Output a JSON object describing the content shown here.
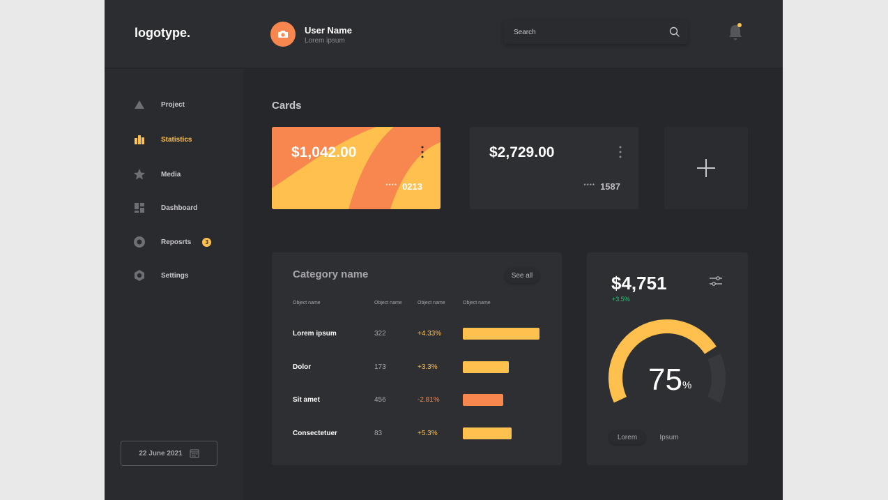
{
  "header": {
    "logo": "logotype.",
    "user_name": "User Name",
    "user_sub": "Lorem ipsum",
    "search_placeholder": "Search"
  },
  "sidebar": {
    "items": [
      {
        "label": "Project",
        "icon": "triangle-icon"
      },
      {
        "label": "Statistics",
        "icon": "bar-chart-icon",
        "active": true
      },
      {
        "label": "Media",
        "icon": "star-icon"
      },
      {
        "label": "Dashboard",
        "icon": "dashboard-icon"
      },
      {
        "label": "Reposrts",
        "icon": "reports-icon",
        "badge": "3"
      },
      {
        "label": "Settings",
        "icon": "settings-icon"
      }
    ],
    "date": "22 June 2021"
  },
  "cards": {
    "title": "Cards",
    "items": [
      {
        "amount": "$1,042.00",
        "mask": "****",
        "number": "0213"
      },
      {
        "amount": "$2,729.00",
        "mask": "****",
        "number": "1587"
      }
    ]
  },
  "category": {
    "title": "Category name",
    "see_all": "See all",
    "headers": [
      "Object name",
      "Object name",
      "Object name",
      "Object name"
    ],
    "rows": [
      {
        "name": "Lorem ipsum",
        "value": "322",
        "pct": "+4.33%",
        "level": 1.0,
        "color": "#ffc04d"
      },
      {
        "name": "Dolor",
        "value": "173",
        "pct": "+3.3%",
        "level": 0.6,
        "color": "#ffc04d"
      },
      {
        "name": "Sit amet",
        "value": "456",
        "pct": "-2.81%",
        "level": 0.53,
        "color": "#f7874f"
      },
      {
        "name": "Consectetuer",
        "value": "83",
        "pct": "+5.3%",
        "level": 0.64,
        "color": "#ffc04d"
      }
    ]
  },
  "stat": {
    "amount": "$4,751",
    "delta": "+3.5%",
    "gauge_value": "75",
    "gauge_unit": "%",
    "gauge_fraction": 0.75,
    "tab1": "Lorem",
    "tab2": "Ipsum"
  },
  "colors": {
    "accent": "#ffc04d",
    "orange": "#f7874f",
    "positive": "#2ec47a"
  }
}
